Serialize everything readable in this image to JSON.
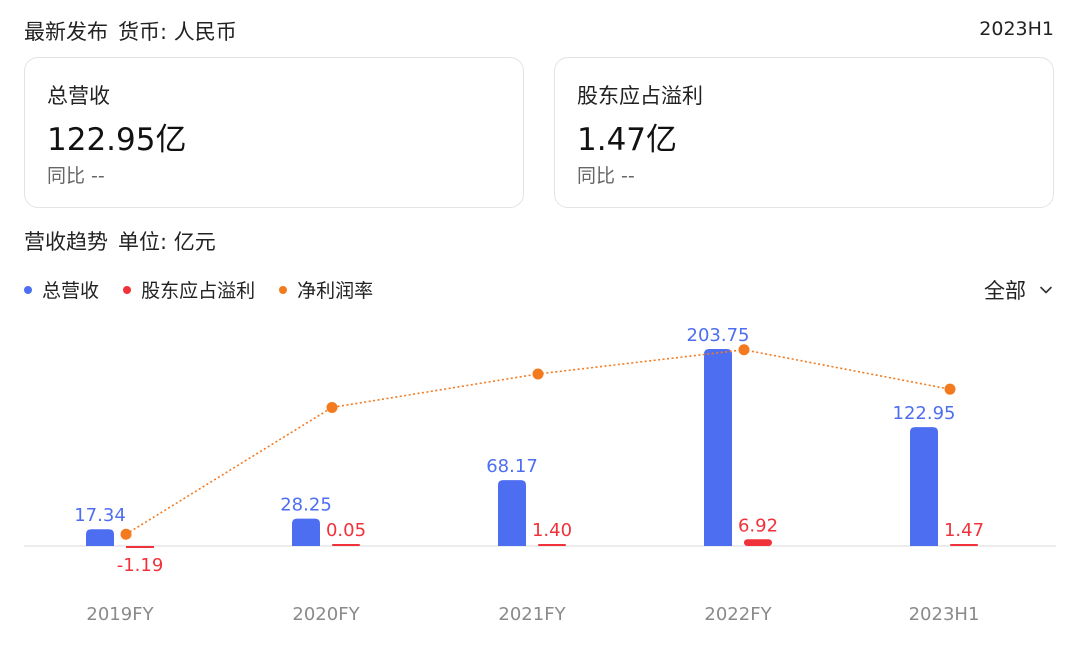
{
  "header": {
    "title": "最新发布",
    "currency": "货币: 人民币",
    "period": "2023H1"
  },
  "cards": [
    {
      "label": "总营收",
      "value": "122.95亿",
      "yoy": "同比 --"
    },
    {
      "label": "股东应占溢利",
      "value": "1.47亿",
      "yoy": "同比 --"
    }
  ],
  "section": {
    "title": "营收趋势",
    "unit": "单位: 亿元"
  },
  "filter": {
    "label": "全部",
    "icon": "chevron-down-icon"
  },
  "colors": {
    "revenue": "#4e6ef2",
    "profit": "#f1323b",
    "margin": "#f47a1f"
  },
  "chart_data": {
    "type": "bar",
    "categories": [
      "2019FY",
      "2020FY",
      "2021FY",
      "2022FY",
      "2023H1"
    ],
    "series": [
      {
        "name": "总营收",
        "kind": "bar",
        "values": [
          17.34,
          28.25,
          68.17,
          203.75,
          122.95
        ],
        "labels": [
          "17.34",
          "28.25",
          "68.17",
          "203.75",
          "122.95"
        ]
      },
      {
        "name": "股东应占溢利",
        "kind": "bar",
        "values": [
          -1.19,
          0.05,
          1.4,
          6.92,
          1.47
        ],
        "labels": [
          "-1.19",
          "0.05",
          "1.40",
          "6.92",
          "1.47"
        ]
      },
      {
        "name": "净利润率",
        "kind": "line",
        "values": [
          -6.9,
          0.18,
          2.05,
          3.4,
          1.2
        ]
      }
    ],
    "legend_position": "top-left",
    "grid": false
  }
}
